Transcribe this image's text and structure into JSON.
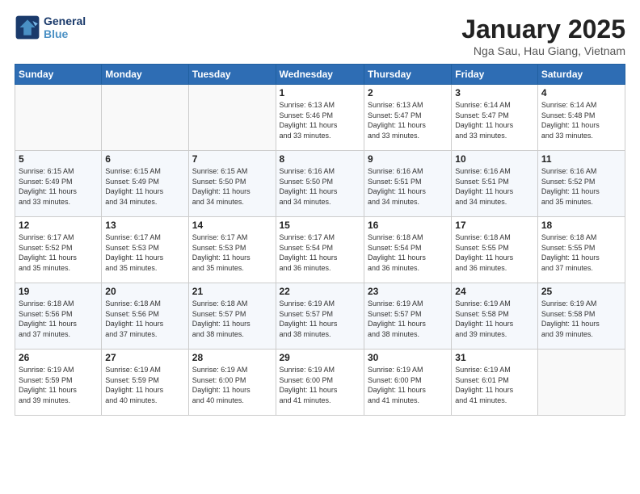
{
  "header": {
    "logo_line1": "General",
    "logo_line2": "Blue",
    "month_title": "January 2025",
    "location": "Nga Sau, Hau Giang, Vietnam"
  },
  "weekdays": [
    "Sunday",
    "Monday",
    "Tuesday",
    "Wednesday",
    "Thursday",
    "Friday",
    "Saturday"
  ],
  "weeks": [
    [
      {
        "day": "",
        "info": ""
      },
      {
        "day": "",
        "info": ""
      },
      {
        "day": "",
        "info": ""
      },
      {
        "day": "1",
        "info": "Sunrise: 6:13 AM\nSunset: 5:46 PM\nDaylight: 11 hours\nand 33 minutes."
      },
      {
        "day": "2",
        "info": "Sunrise: 6:13 AM\nSunset: 5:47 PM\nDaylight: 11 hours\nand 33 minutes."
      },
      {
        "day": "3",
        "info": "Sunrise: 6:14 AM\nSunset: 5:47 PM\nDaylight: 11 hours\nand 33 minutes."
      },
      {
        "day": "4",
        "info": "Sunrise: 6:14 AM\nSunset: 5:48 PM\nDaylight: 11 hours\nand 33 minutes."
      }
    ],
    [
      {
        "day": "5",
        "info": "Sunrise: 6:15 AM\nSunset: 5:49 PM\nDaylight: 11 hours\nand 33 minutes."
      },
      {
        "day": "6",
        "info": "Sunrise: 6:15 AM\nSunset: 5:49 PM\nDaylight: 11 hours\nand 34 minutes."
      },
      {
        "day": "7",
        "info": "Sunrise: 6:15 AM\nSunset: 5:50 PM\nDaylight: 11 hours\nand 34 minutes."
      },
      {
        "day": "8",
        "info": "Sunrise: 6:16 AM\nSunset: 5:50 PM\nDaylight: 11 hours\nand 34 minutes."
      },
      {
        "day": "9",
        "info": "Sunrise: 6:16 AM\nSunset: 5:51 PM\nDaylight: 11 hours\nand 34 minutes."
      },
      {
        "day": "10",
        "info": "Sunrise: 6:16 AM\nSunset: 5:51 PM\nDaylight: 11 hours\nand 34 minutes."
      },
      {
        "day": "11",
        "info": "Sunrise: 6:16 AM\nSunset: 5:52 PM\nDaylight: 11 hours\nand 35 minutes."
      }
    ],
    [
      {
        "day": "12",
        "info": "Sunrise: 6:17 AM\nSunset: 5:52 PM\nDaylight: 11 hours\nand 35 minutes."
      },
      {
        "day": "13",
        "info": "Sunrise: 6:17 AM\nSunset: 5:53 PM\nDaylight: 11 hours\nand 35 minutes."
      },
      {
        "day": "14",
        "info": "Sunrise: 6:17 AM\nSunset: 5:53 PM\nDaylight: 11 hours\nand 35 minutes."
      },
      {
        "day": "15",
        "info": "Sunrise: 6:17 AM\nSunset: 5:54 PM\nDaylight: 11 hours\nand 36 minutes."
      },
      {
        "day": "16",
        "info": "Sunrise: 6:18 AM\nSunset: 5:54 PM\nDaylight: 11 hours\nand 36 minutes."
      },
      {
        "day": "17",
        "info": "Sunrise: 6:18 AM\nSunset: 5:55 PM\nDaylight: 11 hours\nand 36 minutes."
      },
      {
        "day": "18",
        "info": "Sunrise: 6:18 AM\nSunset: 5:55 PM\nDaylight: 11 hours\nand 37 minutes."
      }
    ],
    [
      {
        "day": "19",
        "info": "Sunrise: 6:18 AM\nSunset: 5:56 PM\nDaylight: 11 hours\nand 37 minutes."
      },
      {
        "day": "20",
        "info": "Sunrise: 6:18 AM\nSunset: 5:56 PM\nDaylight: 11 hours\nand 37 minutes."
      },
      {
        "day": "21",
        "info": "Sunrise: 6:18 AM\nSunset: 5:57 PM\nDaylight: 11 hours\nand 38 minutes."
      },
      {
        "day": "22",
        "info": "Sunrise: 6:19 AM\nSunset: 5:57 PM\nDaylight: 11 hours\nand 38 minutes."
      },
      {
        "day": "23",
        "info": "Sunrise: 6:19 AM\nSunset: 5:57 PM\nDaylight: 11 hours\nand 38 minutes."
      },
      {
        "day": "24",
        "info": "Sunrise: 6:19 AM\nSunset: 5:58 PM\nDaylight: 11 hours\nand 39 minutes."
      },
      {
        "day": "25",
        "info": "Sunrise: 6:19 AM\nSunset: 5:58 PM\nDaylight: 11 hours\nand 39 minutes."
      }
    ],
    [
      {
        "day": "26",
        "info": "Sunrise: 6:19 AM\nSunset: 5:59 PM\nDaylight: 11 hours\nand 39 minutes."
      },
      {
        "day": "27",
        "info": "Sunrise: 6:19 AM\nSunset: 5:59 PM\nDaylight: 11 hours\nand 40 minutes."
      },
      {
        "day": "28",
        "info": "Sunrise: 6:19 AM\nSunset: 6:00 PM\nDaylight: 11 hours\nand 40 minutes."
      },
      {
        "day": "29",
        "info": "Sunrise: 6:19 AM\nSunset: 6:00 PM\nDaylight: 11 hours\nand 41 minutes."
      },
      {
        "day": "30",
        "info": "Sunrise: 6:19 AM\nSunset: 6:00 PM\nDaylight: 11 hours\nand 41 minutes."
      },
      {
        "day": "31",
        "info": "Sunrise: 6:19 AM\nSunset: 6:01 PM\nDaylight: 11 hours\nand 41 minutes."
      },
      {
        "day": "",
        "info": ""
      }
    ]
  ]
}
